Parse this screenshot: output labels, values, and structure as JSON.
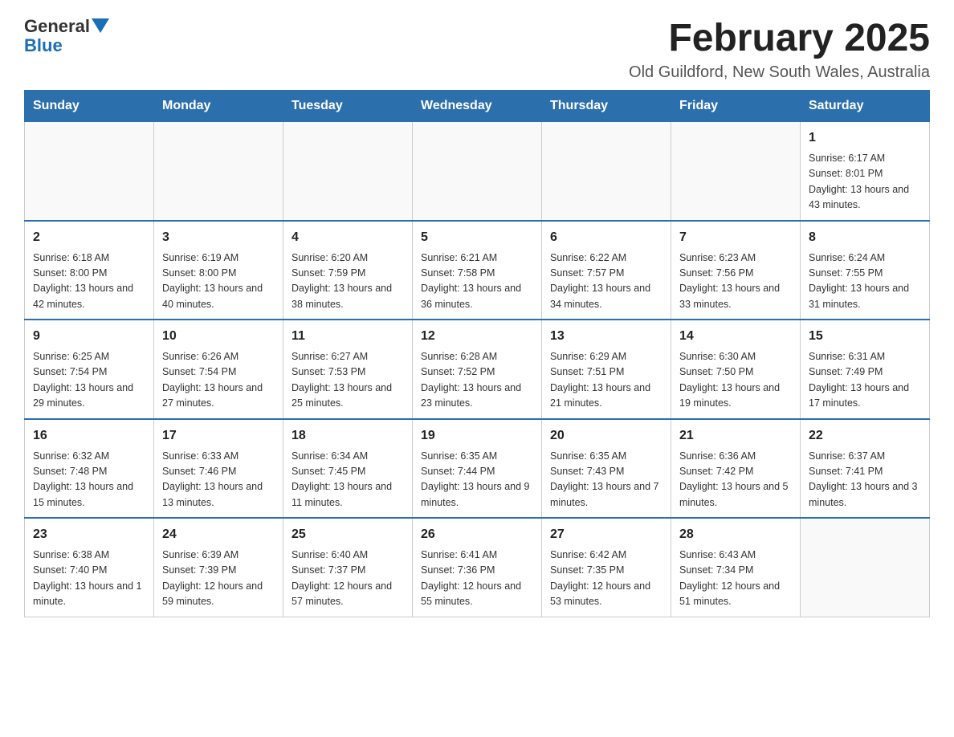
{
  "header": {
    "title": "February 2025",
    "subtitle": "Old Guildford, New South Wales, Australia"
  },
  "logo": {
    "general": "General",
    "blue": "Blue"
  },
  "days_of_week": [
    "Sunday",
    "Monday",
    "Tuesday",
    "Wednesday",
    "Thursday",
    "Friday",
    "Saturday"
  ],
  "weeks": [
    [
      {
        "day": "",
        "info": ""
      },
      {
        "day": "",
        "info": ""
      },
      {
        "day": "",
        "info": ""
      },
      {
        "day": "",
        "info": ""
      },
      {
        "day": "",
        "info": ""
      },
      {
        "day": "",
        "info": ""
      },
      {
        "day": "1",
        "info": "Sunrise: 6:17 AM\nSunset: 8:01 PM\nDaylight: 13 hours and 43 minutes."
      }
    ],
    [
      {
        "day": "2",
        "info": "Sunrise: 6:18 AM\nSunset: 8:00 PM\nDaylight: 13 hours and 42 minutes."
      },
      {
        "day": "3",
        "info": "Sunrise: 6:19 AM\nSunset: 8:00 PM\nDaylight: 13 hours and 40 minutes."
      },
      {
        "day": "4",
        "info": "Sunrise: 6:20 AM\nSunset: 7:59 PM\nDaylight: 13 hours and 38 minutes."
      },
      {
        "day": "5",
        "info": "Sunrise: 6:21 AM\nSunset: 7:58 PM\nDaylight: 13 hours and 36 minutes."
      },
      {
        "day": "6",
        "info": "Sunrise: 6:22 AM\nSunset: 7:57 PM\nDaylight: 13 hours and 34 minutes."
      },
      {
        "day": "7",
        "info": "Sunrise: 6:23 AM\nSunset: 7:56 PM\nDaylight: 13 hours and 33 minutes."
      },
      {
        "day": "8",
        "info": "Sunrise: 6:24 AM\nSunset: 7:55 PM\nDaylight: 13 hours and 31 minutes."
      }
    ],
    [
      {
        "day": "9",
        "info": "Sunrise: 6:25 AM\nSunset: 7:54 PM\nDaylight: 13 hours and 29 minutes."
      },
      {
        "day": "10",
        "info": "Sunrise: 6:26 AM\nSunset: 7:54 PM\nDaylight: 13 hours and 27 minutes."
      },
      {
        "day": "11",
        "info": "Sunrise: 6:27 AM\nSunset: 7:53 PM\nDaylight: 13 hours and 25 minutes."
      },
      {
        "day": "12",
        "info": "Sunrise: 6:28 AM\nSunset: 7:52 PM\nDaylight: 13 hours and 23 minutes."
      },
      {
        "day": "13",
        "info": "Sunrise: 6:29 AM\nSunset: 7:51 PM\nDaylight: 13 hours and 21 minutes."
      },
      {
        "day": "14",
        "info": "Sunrise: 6:30 AM\nSunset: 7:50 PM\nDaylight: 13 hours and 19 minutes."
      },
      {
        "day": "15",
        "info": "Sunrise: 6:31 AM\nSunset: 7:49 PM\nDaylight: 13 hours and 17 minutes."
      }
    ],
    [
      {
        "day": "16",
        "info": "Sunrise: 6:32 AM\nSunset: 7:48 PM\nDaylight: 13 hours and 15 minutes."
      },
      {
        "day": "17",
        "info": "Sunrise: 6:33 AM\nSunset: 7:46 PM\nDaylight: 13 hours and 13 minutes."
      },
      {
        "day": "18",
        "info": "Sunrise: 6:34 AM\nSunset: 7:45 PM\nDaylight: 13 hours and 11 minutes."
      },
      {
        "day": "19",
        "info": "Sunrise: 6:35 AM\nSunset: 7:44 PM\nDaylight: 13 hours and 9 minutes."
      },
      {
        "day": "20",
        "info": "Sunrise: 6:35 AM\nSunset: 7:43 PM\nDaylight: 13 hours and 7 minutes."
      },
      {
        "day": "21",
        "info": "Sunrise: 6:36 AM\nSunset: 7:42 PM\nDaylight: 13 hours and 5 minutes."
      },
      {
        "day": "22",
        "info": "Sunrise: 6:37 AM\nSunset: 7:41 PM\nDaylight: 13 hours and 3 minutes."
      }
    ],
    [
      {
        "day": "23",
        "info": "Sunrise: 6:38 AM\nSunset: 7:40 PM\nDaylight: 13 hours and 1 minute."
      },
      {
        "day": "24",
        "info": "Sunrise: 6:39 AM\nSunset: 7:39 PM\nDaylight: 12 hours and 59 minutes."
      },
      {
        "day": "25",
        "info": "Sunrise: 6:40 AM\nSunset: 7:37 PM\nDaylight: 12 hours and 57 minutes."
      },
      {
        "day": "26",
        "info": "Sunrise: 6:41 AM\nSunset: 7:36 PM\nDaylight: 12 hours and 55 minutes."
      },
      {
        "day": "27",
        "info": "Sunrise: 6:42 AM\nSunset: 7:35 PM\nDaylight: 12 hours and 53 minutes."
      },
      {
        "day": "28",
        "info": "Sunrise: 6:43 AM\nSunset: 7:34 PM\nDaylight: 12 hours and 51 minutes."
      },
      {
        "day": "",
        "info": ""
      }
    ]
  ]
}
